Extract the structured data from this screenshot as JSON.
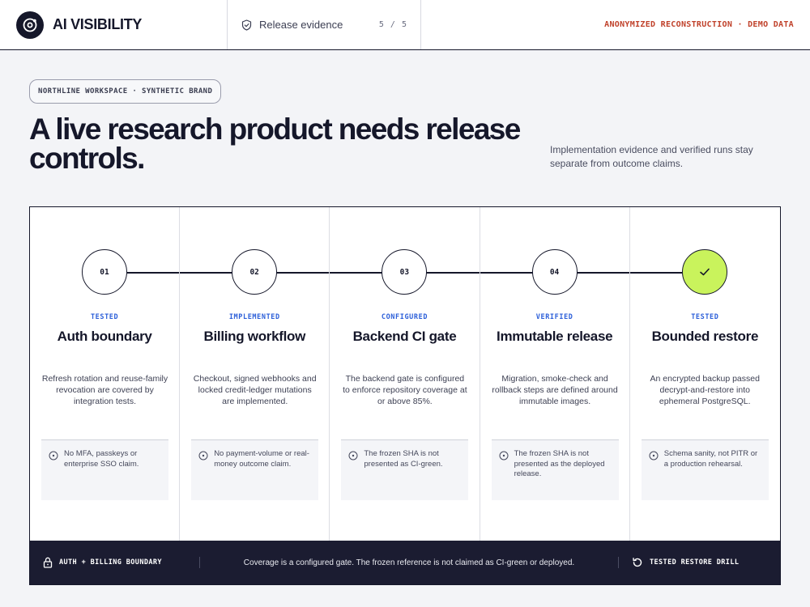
{
  "header": {
    "brand_name": "AI VISIBILITY",
    "brand_icon": "orbit-logo-icon",
    "crumb_icon": "shield-check-icon",
    "crumb_label": "Release evidence",
    "crumb_count": "5 / 5",
    "notice": "ANONYMIZED RECONSTRUCTION · DEMO DATA"
  },
  "hero": {
    "workspace_pill": "NORTHLINE WORKSPACE · SYNTHETIC BRAND",
    "headline": "A live research product needs release controls.",
    "subtext": "Implementation evidence and verified runs stay separate from outcome claims."
  },
  "stages": [
    {
      "number": "01",
      "status": "TESTED",
      "title": "Auth boundary",
      "description": "Refresh rotation and reuse-family revocation are covered by integration tests.",
      "caveat": "No MFA, passkeys or enterprise SSO claim.",
      "done": false
    },
    {
      "number": "02",
      "status": "IMPLEMENTED",
      "title": "Billing workflow",
      "description": "Checkout, signed webhooks and locked credit-ledger mutations are implemented.",
      "caveat": "No payment-volume or real-money outcome claim.",
      "done": false
    },
    {
      "number": "03",
      "status": "CONFIGURED",
      "title": "Backend CI gate",
      "description": "The backend gate is configured to enforce repository coverage at or above 85%.",
      "caveat": "The frozen SHA is not presented as CI-green.",
      "done": false
    },
    {
      "number": "04",
      "status": "VERIFIED",
      "title": "Immutable release",
      "description": "Migration, smoke-check and rollback steps are defined around immutable images.",
      "caveat": "The frozen SHA is not presented as the deployed release.",
      "done": false
    },
    {
      "number": "",
      "status": "TESTED",
      "title": "Bounded restore",
      "description": "An encrypted backup passed decrypt-and-restore into ephemeral PostgreSQL.",
      "caveat": "Schema sanity, not PITR or a production rehearsal.",
      "done": true
    }
  ],
  "footer": {
    "left_icon": "lock-icon",
    "left_label": "AUTH + BILLING BOUNDARY",
    "middle_text": "Coverage is a configured gate. The frozen reference is not claimed as CI-green or deployed.",
    "right_icon": "restore-icon",
    "right_label": "TESTED RESTORE DRILL"
  },
  "colors": {
    "ink": "#15172a",
    "accent_status": "#2c5fd9",
    "done_fill": "#c9f35c",
    "notice": "#c0412a",
    "footer_bg": "#1b1c31"
  }
}
